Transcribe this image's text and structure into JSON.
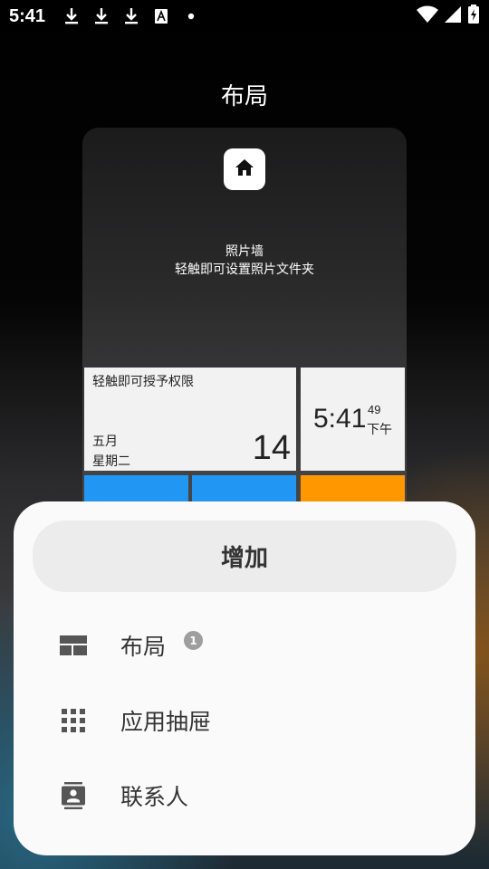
{
  "status_bar": {
    "time": "5:41",
    "notification_icons": [
      "download-icon",
      "download-icon",
      "download-icon",
      "font-a-icon",
      "dot-icon"
    ],
    "right_icons": [
      "wifi-icon",
      "signal-icon",
      "battery-charging-icon"
    ]
  },
  "page": {
    "title": "布局"
  },
  "preview": {
    "home_icon": "home-icon",
    "photo_wall_title": "照片墙",
    "photo_wall_hint": "轻触即可设置照片文件夹",
    "date_tile": {
      "permission_hint": "轻触即可授予权限",
      "month": "五月",
      "weekday": "星期二",
      "day": "14"
    },
    "clock_tile": {
      "time": "5:41",
      "seconds": "49",
      "ampm": "下午"
    },
    "tile_colors": {
      "blue": "#2196f3",
      "orange": "#ff9800"
    }
  },
  "sheet": {
    "add_label": "增加",
    "items": [
      {
        "label": "布局",
        "icon": "layout-icon",
        "badge": "1"
      },
      {
        "label": "应用抽屉",
        "icon": "app-grid-icon"
      },
      {
        "label": "联系人",
        "icon": "contacts-icon"
      }
    ]
  }
}
